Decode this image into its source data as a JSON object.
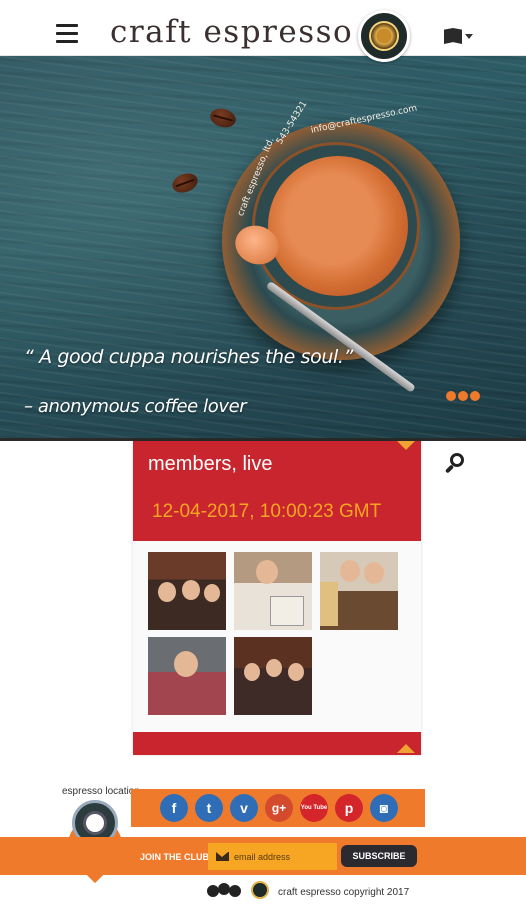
{
  "header": {
    "brand": "craft espresso"
  },
  "hero": {
    "cup_text_left": "craft espresso, ltd.",
    "cup_text_mid": "543-54321",
    "cup_text_right": "info@craftespresso.com",
    "quote": "“ A good cuppa nourishes the soul.”",
    "author": "– anonymous coffee lover"
  },
  "members": {
    "title": "members, live",
    "timestamp": "12-04-2017, 10:00:23 GMT"
  },
  "location": {
    "label": "espresso location"
  },
  "social": {
    "icons": [
      "facebook-icon",
      "twitter-icon",
      "vimeo-icon",
      "google-plus-icon",
      "youtube-icon",
      "pinterest-icon",
      "instagram-icon"
    ],
    "facebook": "f",
    "twitter": "t",
    "vimeo": "v",
    "google_plus": "g+",
    "youtube": "You Tube",
    "pinterest": "p",
    "instagram": "◙"
  },
  "newsletter": {
    "label": "JOIN THE CLUB",
    "placeholder": "email address",
    "button": "SUBSCRIBE"
  },
  "footer": {
    "copyright": "craft espresso copyright 2017"
  },
  "colors": {
    "accent_red": "#c8252e",
    "accent_orange": "#f07a2c",
    "accent_gold": "#f6a623"
  }
}
